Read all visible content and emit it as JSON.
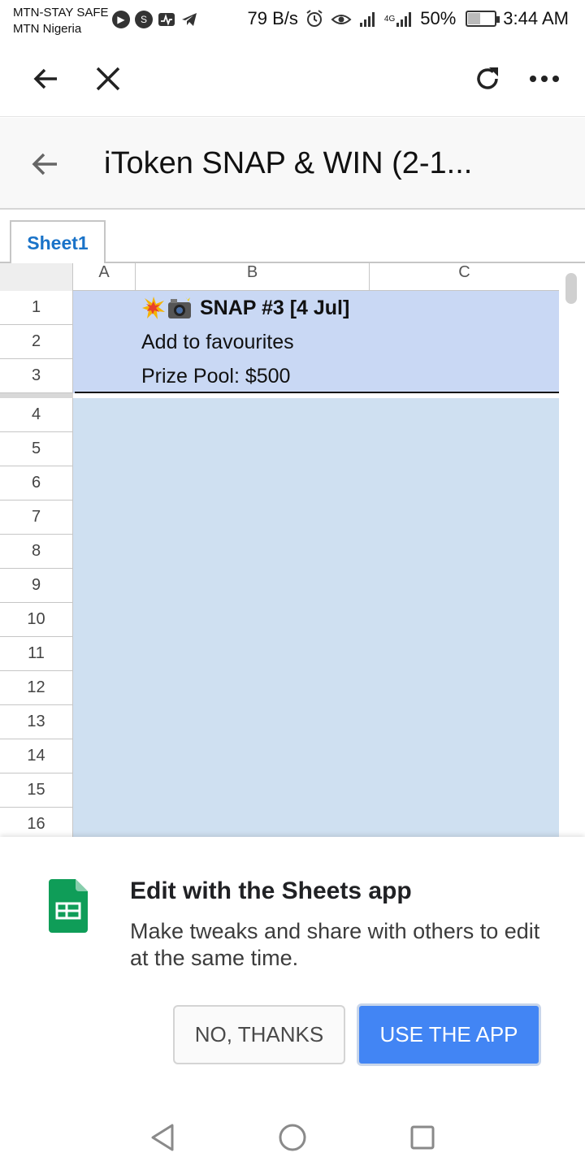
{
  "status_bar": {
    "carrier_line1": "MTN-STAY SAFE",
    "carrier_line2": "MTN Nigeria",
    "net_speed": "79 B/s",
    "network_label": "4G",
    "battery": "50%",
    "battery_level": 0.5,
    "time": "3:44 AM",
    "icons": [
      "play-icon",
      "s-icon",
      "activity-icon",
      "telegram-icon",
      "alarm-icon",
      "eye-icon",
      "signal-icon",
      "signal-4g-icon",
      "battery-icon"
    ]
  },
  "browser": {
    "icons": [
      "back-arrow-icon",
      "close-icon",
      "refresh-icon",
      "more-dots-icon"
    ]
  },
  "doc": {
    "title": "iToken SNAP & WIN (2-1..."
  },
  "sheet_tab": {
    "label": "Sheet1"
  },
  "grid": {
    "columns": [
      "A",
      "B",
      "C"
    ],
    "rows": [
      "1",
      "2",
      "3",
      "4",
      "5",
      "6",
      "7",
      "8",
      "9",
      "10",
      "11",
      "12",
      "13",
      "14",
      "15",
      "16"
    ],
    "cells": {
      "b1": "SNAP #3 [4 Jul]",
      "b2": "Add to favourites",
      "b3": "Prize Pool: $500"
    },
    "b1_emojis": [
      "collision-emoji",
      "camera-flash-emoji"
    ],
    "selection_color": "#c9d8f4"
  },
  "bottom_sheet": {
    "title": "Edit with the Sheets app",
    "text": "Make tweaks and share with others to edit at the same time.",
    "no_button": "NO, THANKS",
    "use_button": "USE THE APP",
    "accent": "#4285f4",
    "logo_color": "#0f9d58"
  },
  "nav": {
    "icons": [
      "nav-back-icon",
      "nav-home-icon",
      "nav-recents-icon"
    ]
  }
}
